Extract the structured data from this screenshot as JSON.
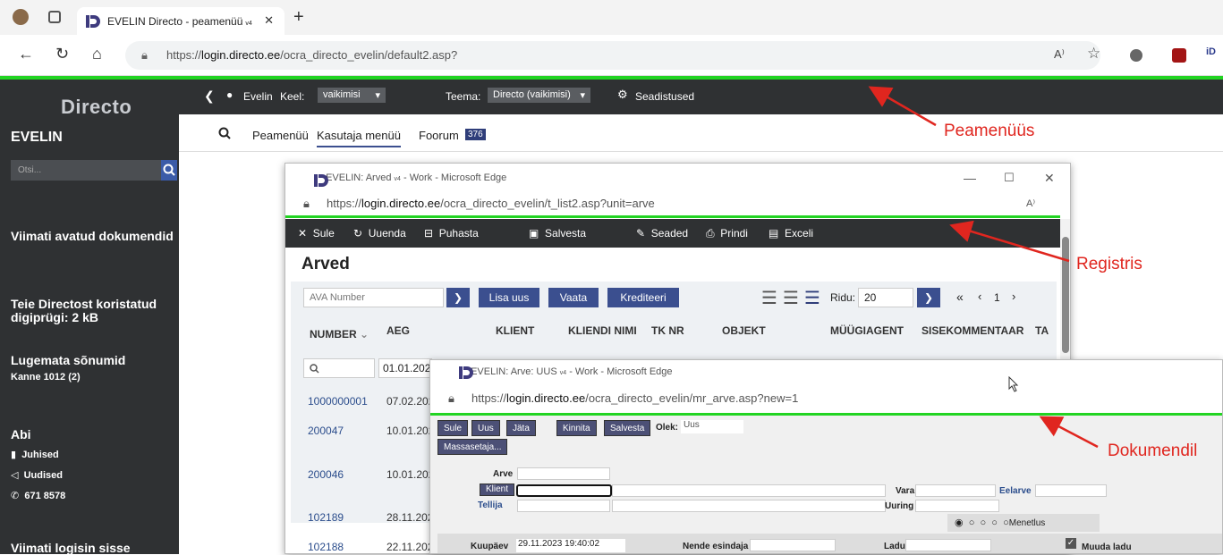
{
  "browser": {
    "tab_title": "EVELIN Directo - peamenüü",
    "tab_badge": "v4",
    "url_prefix": "https://",
    "url_host": "login.directo.ee",
    "url_path": "/ocra_directo_evelin/default2.asp?"
  },
  "app": {
    "logo": "Directo",
    "user_company": "EVELIN",
    "search_placeholder": "Otsi...",
    "topbar": {
      "user": "Evelin",
      "lang_label": "Keel:",
      "lang_value": "vaikimisi",
      "theme_label": "Teema:",
      "theme_value": "Directo (vaikimisi)",
      "settings": "Seadistused"
    },
    "subnav": {
      "items": [
        "Peamenüü",
        "Kasutaja menüü",
        "Foorum"
      ],
      "forum_badge": "376"
    },
    "sidebar": {
      "recent_docs": "Viimati avatud dokumendid",
      "trash": "Teie Directost koristatud digiprügi: 2 kB",
      "unread": "Lugemata sõnumid",
      "unread_item": "Kanne 1012 (2)",
      "help": "Abi",
      "help_items": [
        "Juhised",
        "Uudised",
        "671 8578"
      ],
      "last_login": "Viimati logisin sisse"
    }
  },
  "register_window": {
    "title": "EVELIN: Arved",
    "title_badge": "v4",
    "title_suffix": "- Work - Microsoft Edge",
    "url_host": "login.directo.ee",
    "url_path": "/ocra_directo_evelin/t_list2.asp?unit=arve",
    "toolbar": [
      "Sule",
      "Uuenda",
      "Puhasta väljad",
      "Salvesta vaade",
      "Seaded",
      "Prindi",
      "Exceli tabel"
    ],
    "heading": "Arved",
    "search_placeholder": "AVA Number",
    "buttons": [
      "Lisa uus",
      "Vaata",
      "Krediteeri"
    ],
    "rows_label": "Ridu:",
    "rows_value": "20",
    "page": "1",
    "columns": [
      "NUMBER",
      "AEG",
      "KLIENT",
      "KLIENDI NIMI",
      "TK NR",
      "OBJEKT",
      "MÜÜGIAGENT",
      "SISEKOMMENTAAR",
      "TA"
    ],
    "filter_date": "01.01.202",
    "rows": [
      {
        "number": "1000000001",
        "date": "07.02.202"
      },
      {
        "number": "200047",
        "date": "10.01.202"
      },
      {
        "number": "200046",
        "date": "10.01.202"
      },
      {
        "number": "102189",
        "date": "28.11.202"
      },
      {
        "number": "102188",
        "date": "22.11.202"
      }
    ]
  },
  "document_window": {
    "title": "EVELIN: Arve: UUS",
    "title_badge": "v4",
    "title_suffix": "- Work - Microsoft Edge",
    "url_host": "login.directo.ee",
    "url_path": "/ocra_directo_evelin/mr_arve.asp?new=1",
    "buttons": [
      "Sule",
      "Uus",
      "Jäta",
      "Kinnita",
      "Salvesta"
    ],
    "status_label": "Olek:",
    "status_value": "Uus",
    "mass_button": "Massasetaja...",
    "fields": {
      "arve": "Arve",
      "klient": "Klient",
      "vara": "Vara",
      "eelarve": "Eelarve",
      "tellija": "Tellija",
      "uuring": "Uuring",
      "menetlus": "Menetlus",
      "kuupaev_label": "Kuupäev",
      "kuupaev_value": "29.11.2023 19:40:02",
      "nende_esindaja": "Nende esindaja",
      "ladu": "Ladu",
      "muuda_ladu": "Muuda ladu"
    }
  },
  "annotations": [
    "Peamenüüs",
    "Registris",
    "Dokumendil"
  ],
  "colors": {
    "accent_green": "#22d422",
    "dark_bar": "#2f3133",
    "annotation_red": "#e0261f",
    "button_blue": "#3b4f8f"
  }
}
